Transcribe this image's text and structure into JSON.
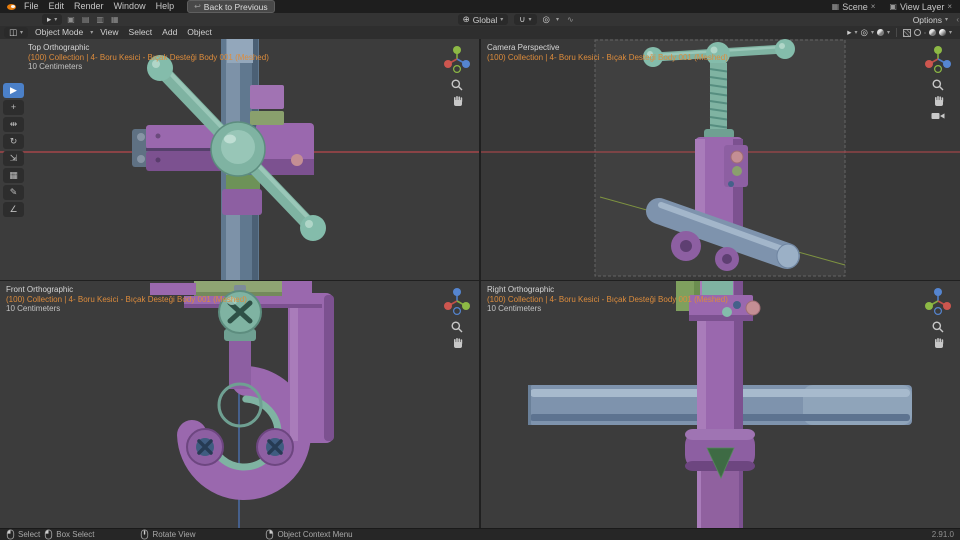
{
  "topbar": {
    "menus": [
      "File",
      "Edit",
      "Render",
      "Window",
      "Help"
    ],
    "back_button": "Back to Previous",
    "scene": "Scene",
    "view_layer": "View Layer"
  },
  "tool_settings": {
    "orientation": "Global",
    "options": "Options"
  },
  "viewport_header": {
    "mode": "Object Mode",
    "menu_view": "View",
    "menu_select": "Select",
    "menu_add": "Add",
    "menu_object": "Object"
  },
  "viewports": {
    "top_left": {
      "title": "Top Orthographic",
      "breadcrumb": "(100) Collection | 4- Boru Kesici - Bıçak Desteği Body 001 (Meshed)",
      "grid_scale": "10 Centimeters"
    },
    "top_right": {
      "title": "Camera Perspective",
      "breadcrumb": "(100) Collection | 4- Boru Kesici - Bıçak Desteği Body 001 (Meshed)"
    },
    "bottom_left": {
      "title": "Front Orthographic",
      "breadcrumb": "(100) Collection | 4- Boru Kesici - Bıçak Desteği Body 001 (Meshed)",
      "grid_scale": "10 Centimeters"
    },
    "bottom_right": {
      "title": "Right Orthographic",
      "breadcrumb": "(100) Collection | 4- Boru Kesici - Bıçak Desteği Body 001 (Meshed)",
      "grid_scale": "10 Centimeters"
    }
  },
  "status_bar": {
    "select": "Select",
    "box_select": "Box Select",
    "rotate_view": "Rotate View",
    "context_menu": "Object Context Menu",
    "version": "2.91.0"
  },
  "icons": {
    "caret": "▾",
    "close": "×",
    "back_arrow": "↩",
    "globe": "⊕",
    "magnet": "∪",
    "proportional": "◎",
    "falloff": "∿",
    "scene": "▦",
    "view_layer": "▣",
    "editor_type": "◫",
    "pointer": "▸",
    "region_toggle": "‹"
  },
  "tools": [
    "▶",
    "+",
    "⇹",
    "↻",
    "⇲",
    "▦",
    "✎",
    "∠"
  ],
  "colors": {
    "accent_blue": "#4b80c8",
    "selection_orange": "#dd8c3c",
    "body_purple": "#9a68ae",
    "handle_teal": "#7fb3a2",
    "pipe_blue": "#7e93ad",
    "axis_red": "#b8474d",
    "axis_green": "#7e9340",
    "axis_blue": "#4d78c2"
  }
}
